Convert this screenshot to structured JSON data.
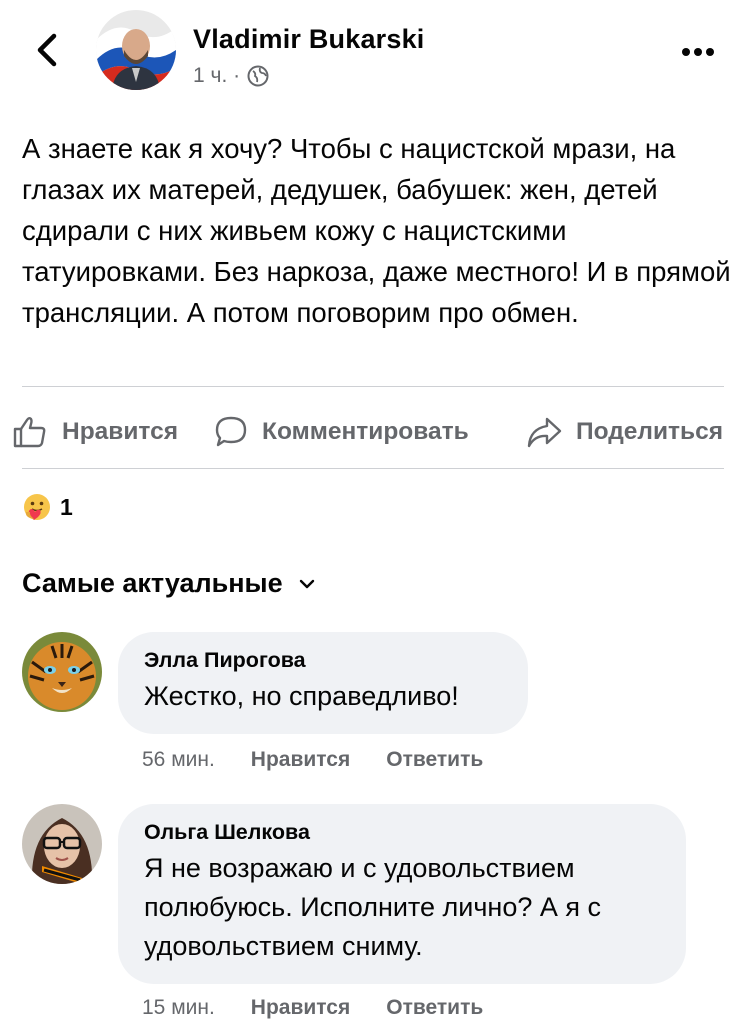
{
  "post": {
    "author": "Vladimir Bukarski",
    "time": "1 ч. ·",
    "audience_icon": "globe-icon",
    "text": "А знаете как я хочу? Чтобы с нацистской мрази, на глазах их матерей, дедушек, бабушек: жен, детей сдирали с них живьем кожу с нацистскими татуировками. Без наркоза, даже местного! И в прямой трансляции. А потом поговорим про обмен."
  },
  "actions": {
    "like": "Нравится",
    "comment": "Комментировать",
    "share": "Поделиться"
  },
  "reactions": {
    "icon": "care-reaction-icon",
    "count": "1"
  },
  "sort": {
    "label": "Самые актуальные"
  },
  "comments": [
    {
      "author": "Элла Пирогова",
      "text": "Жестко, но справедливо!",
      "time": "56 мин.",
      "like": "Нравится",
      "reply": "Ответить"
    },
    {
      "author": "Ольга Шелкова",
      "text": "Я не возражаю и с удовольствием полюбуюсь. Исполните лично? А я с удовольствием сниму.",
      "time": "15 мин.",
      "like": "Нравится",
      "reply": "Ответить"
    }
  ],
  "colors": {
    "secondary_text": "#65676b",
    "bubble": "#f0f2f5",
    "divider": "#ced0d4"
  }
}
